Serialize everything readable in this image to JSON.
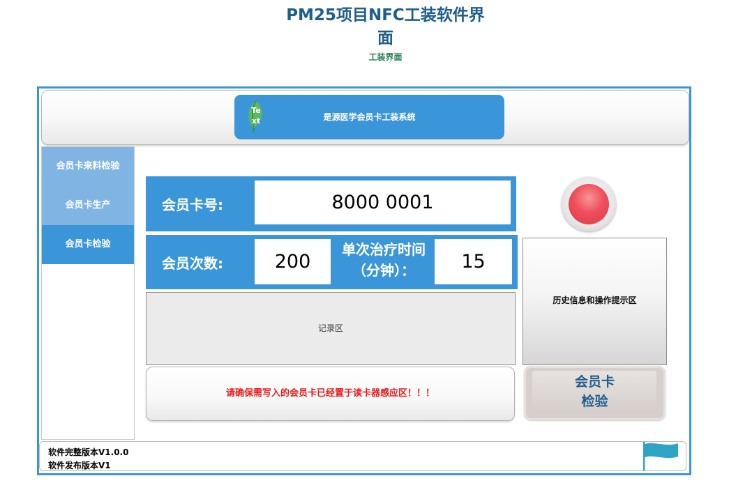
{
  "page": {
    "title_line1": "PM25项目NFC工装软件界",
    "title_line2": "面",
    "subtitle": "工装界面"
  },
  "header": {
    "leaf_icon_text": "Text",
    "system_name": "是源医学会员卡工装系统"
  },
  "sidebar": {
    "items": [
      {
        "label": "会员卡来料检验",
        "active": false
      },
      {
        "label": "会员卡生产",
        "active": false
      },
      {
        "label": "会员卡检验",
        "active": true
      }
    ]
  },
  "form": {
    "card_number_label": "会员卡号:",
    "card_number_value": "8000 0001",
    "times_label": "会员次数:",
    "times_value": "200",
    "duration_label_line1": "单次治疗时间",
    "duration_label_line2": "（分钟）：",
    "duration_value": "15"
  },
  "record_area": {
    "label": "记录区"
  },
  "history_area": {
    "label": "历史信息和操作提示区"
  },
  "warning": {
    "text": "请确保需写入的会员卡已经置于读卡器感应区！！！"
  },
  "check_button": {
    "line1": "会员卡",
    "line2": "检验"
  },
  "status_light": {
    "state": "red"
  },
  "footer": {
    "full_version": "软件完整版本V1.0.0",
    "release_version": "软件发布版本V1"
  },
  "colors": {
    "primary_blue": "#3a96d8",
    "light_blue": "#7fb4e3",
    "title_blue": "#1f5d8a",
    "warning_red": "#e31e1e",
    "status_red": "#ef4f5c"
  },
  "icons": [
    "leaf-icon",
    "flag-icon"
  ]
}
